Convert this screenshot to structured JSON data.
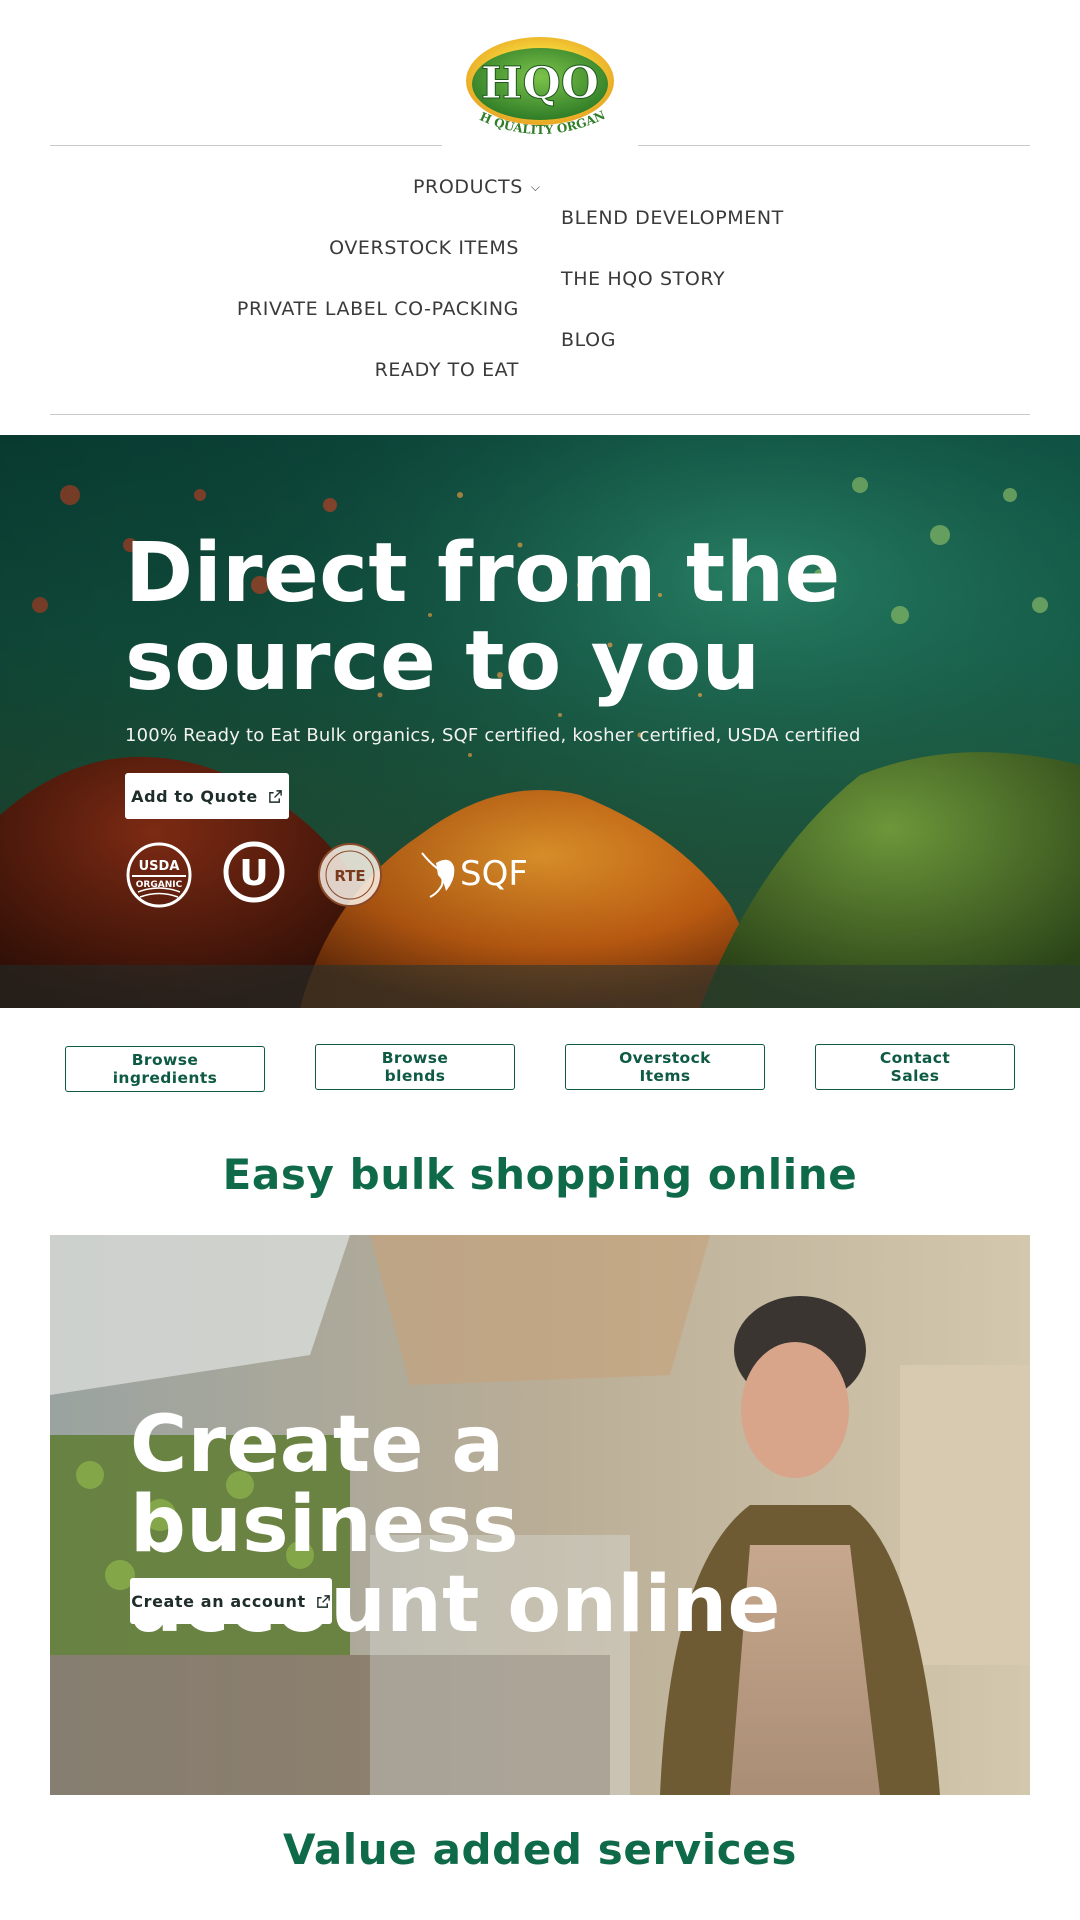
{
  "brand": {
    "logo_text": "HQO",
    "logo_tagline": "HIGH QUALITY ORGANICS",
    "colors": {
      "primary_green": "#0e6a48",
      "logo_yellow": "#f3d23a",
      "logo_green": "#3f9a2f"
    }
  },
  "nav": {
    "left": [
      "PRODUCTS",
      "OVERSTOCK ITEMS",
      "PRIVATE LABEL CO-PACKING",
      "READY TO EAT"
    ],
    "right": [
      "BLEND DEVELOPMENT",
      "THE HQO STORY",
      "BLOG"
    ],
    "products_icon": "chevron-down-icon"
  },
  "hero": {
    "title": "Direct from the source to you",
    "subtitle": "100% Ready to Eat Bulk organics, SQF certified, kosher certified, USDA certified",
    "cta_label": "Add to Quote",
    "cta_icon": "external-link-icon",
    "badges": [
      {
        "name": "usda-organic-badge",
        "line1": "USDA",
        "line2": "ORGANIC"
      },
      {
        "name": "kosher-u-badge",
        "line1": "U"
      },
      {
        "name": "rte-badge",
        "line1": "RTE"
      },
      {
        "name": "sqf-badge",
        "line1": "SQF"
      }
    ]
  },
  "quick_links": [
    "Browse ingredients",
    "Browse blends",
    "Overstock Items",
    "Contact Sales"
  ],
  "sections": {
    "easy_title": "Easy bulk shopping online",
    "value_title": "Value added services"
  },
  "account_banner": {
    "title": "Create a business account online",
    "cta_label": "Create an account",
    "cta_icon": "external-link-icon"
  }
}
